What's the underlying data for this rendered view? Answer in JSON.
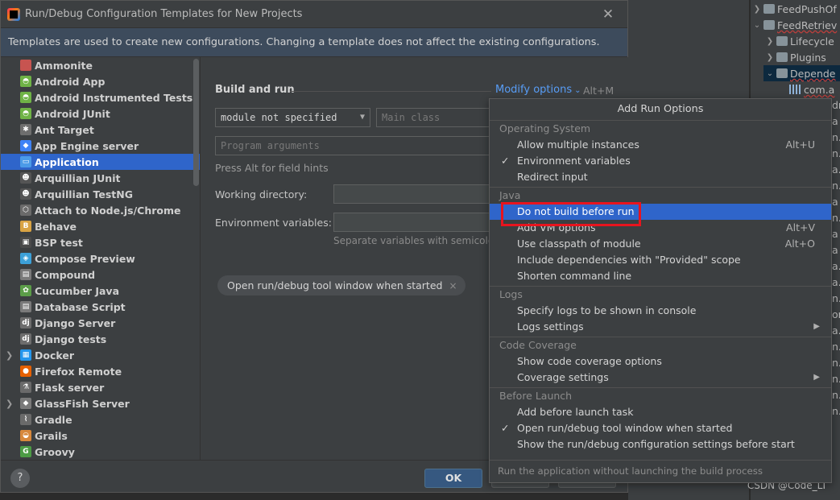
{
  "dialog": {
    "title": "Run/Debug Configuration Templates for New Projects",
    "close_glyph": "✕",
    "banner": "Templates are used to create new configurations. Changing a template does not affect the existing configurations."
  },
  "templates_list": [
    {
      "label": "Ammonite",
      "icon": "ammonite-icon",
      "color": "#c75450",
      "glyph": ""
    },
    {
      "label": "Android App",
      "icon": "android-icon",
      "color": "#6fb346",
      "glyph": "◓"
    },
    {
      "label": "Android Instrumented Tests",
      "icon": "android-icon",
      "color": "#6fb346",
      "glyph": "◓"
    },
    {
      "label": "Android JUnit",
      "icon": "android-icon",
      "color": "#6fb346",
      "glyph": "◓"
    },
    {
      "label": "Ant Target",
      "icon": "ant-icon",
      "color": "#6e6e6e",
      "glyph": "✱"
    },
    {
      "label": "App Engine server",
      "icon": "app-engine-icon",
      "color": "#3e82f7",
      "glyph": "◆"
    },
    {
      "label": "Application",
      "icon": "application-icon",
      "color": "#4b9be8",
      "glyph": "▭",
      "selected": true
    },
    {
      "label": "Arquillian JUnit",
      "icon": "arquillian-icon",
      "color": "#555555",
      "glyph": "☻"
    },
    {
      "label": "Arquillian TestNG",
      "icon": "arquillian-icon",
      "color": "#555555",
      "glyph": "☻"
    },
    {
      "label": "Attach to Node.js/Chrome",
      "icon": "nodejs-icon",
      "color": "#6a6a6a",
      "glyph": "⬡"
    },
    {
      "label": "Behave",
      "icon": "behave-icon",
      "color": "#d9a343",
      "glyph": "B"
    },
    {
      "label": "BSP test",
      "icon": "bsp-icon",
      "color": "#4a4a4a",
      "glyph": "▣"
    },
    {
      "label": "Compose Preview",
      "icon": "compose-icon",
      "color": "#3ca0d8",
      "glyph": "◈"
    },
    {
      "label": "Compound",
      "icon": "compound-icon",
      "color": "#7a7a7a",
      "glyph": "▤"
    },
    {
      "label": "Cucumber Java",
      "icon": "cucumber-icon",
      "color": "#5b9d48",
      "glyph": "✿"
    },
    {
      "label": "Database Script",
      "icon": "database-script-icon",
      "color": "#7a7a7a",
      "glyph": "▤"
    },
    {
      "label": "Django Server",
      "icon": "django-icon",
      "color": "#6d6d6d",
      "glyph": "dj"
    },
    {
      "label": "Django tests",
      "icon": "django-icon",
      "color": "#6d6d6d",
      "glyph": "dj"
    },
    {
      "label": "Docker",
      "icon": "docker-icon",
      "color": "#2496ed",
      "glyph": "▦",
      "expandable": true
    },
    {
      "label": "Firefox Remote",
      "icon": "firefox-icon",
      "color": "#e66000",
      "glyph": "●"
    },
    {
      "label": "Flask server",
      "icon": "flask-icon",
      "color": "#6a6a6a",
      "glyph": "⚗"
    },
    {
      "label": "GlassFish Server",
      "icon": "glassfish-icon",
      "color": "#7a7a7a",
      "glyph": "⬥",
      "expandable": true
    },
    {
      "label": "Gradle",
      "icon": "gradle-icon",
      "color": "#6a6a6a",
      "glyph": "⌇"
    },
    {
      "label": "Grails",
      "icon": "grails-icon",
      "color": "#d7883b",
      "glyph": "◒"
    },
    {
      "label": "Groovy",
      "icon": "groovy-icon",
      "color": "#4c9b45",
      "glyph": "G"
    }
  ],
  "form": {
    "section_title": "Build and run",
    "modify_options": "Modify options",
    "modify_options_chevron": "⌄",
    "modify_shortcut": "Alt+M",
    "module_value": "module not specified",
    "module_caret": "▼",
    "main_class_placeholder": "Main class",
    "program_args_placeholder": "Program arguments",
    "field_hint": "Press Alt for field hints",
    "working_directory_label": "Working directory:",
    "environment_variables_label": "Environment variables:",
    "env_hint": "Separate variables with semicolon",
    "chip_label": "Open run/debug tool window when started",
    "chip_close": "×"
  },
  "footer": {
    "help": "?",
    "ok": "OK"
  },
  "popup": {
    "title": "Add Run Options",
    "groups": [
      {
        "header": "Operating System",
        "items": [
          {
            "label": "Allow multiple instances",
            "shortcut": "Alt+U"
          },
          {
            "label": "Environment variables",
            "checked": true
          },
          {
            "label": "Redirect input"
          }
        ]
      },
      {
        "header": "Java",
        "items": [
          {
            "label": "Do not build before run",
            "highlight": true
          },
          {
            "label": "Add VM options",
            "shortcut": "Alt+V"
          },
          {
            "label": "Use classpath of module",
            "shortcut": "Alt+O"
          },
          {
            "label": "Include dependencies with \"Provided\" scope"
          },
          {
            "label": "Shorten command line"
          }
        ]
      },
      {
        "header": "Logs",
        "items": [
          {
            "label": "Specify logs to be shown in console"
          },
          {
            "label": "Logs settings",
            "submenu": true
          }
        ]
      },
      {
        "header": "Code Coverage",
        "items": [
          {
            "label": "Show code coverage options"
          },
          {
            "label": "Coverage settings",
            "submenu": true
          }
        ]
      },
      {
        "header": "Before Launch",
        "items": [
          {
            "label": "Add before launch task"
          },
          {
            "label": "Open run/debug tool window when started",
            "checked": true
          },
          {
            "label": "Show the run/debug configuration settings before start"
          }
        ]
      }
    ],
    "check_glyph": "✓",
    "submenu_glyph": "▶",
    "footer_hint": "Run the application without launching the build process"
  },
  "project_tree": [
    {
      "label": "FeedPushOf",
      "chevron": "❯",
      "icon": "folder"
    },
    {
      "label": "FeedRetriev",
      "chevron": "⌄",
      "icon": "folder",
      "underline": true
    },
    {
      "label": "Lifecycle",
      "chevron": "❯",
      "icon": "folder",
      "indent": 1
    },
    {
      "label": "Plugins",
      "chevron": "❯",
      "icon": "folder",
      "indent": 1
    },
    {
      "label": "Depende",
      "chevron": "⌄",
      "icon": "folder",
      "indent": 1,
      "selected": true,
      "underline": true
    },
    {
      "label": "com.a",
      "chevron": "",
      "icon": "bars",
      "indent": 2,
      "underline": true
    }
  ],
  "tree_fragments": [
    "dr",
    "a",
    "n.h",
    "n.h",
    "a.s",
    "n.h",
    "a",
    "n.h",
    "a",
    "a",
    "a.s",
    "a.s",
    "n.c",
    "org",
    "a.s",
    "n.f",
    "n.f",
    "n.f",
    "n.f",
    "n.js"
  ],
  "watermark": "CSDN @Code_LT"
}
